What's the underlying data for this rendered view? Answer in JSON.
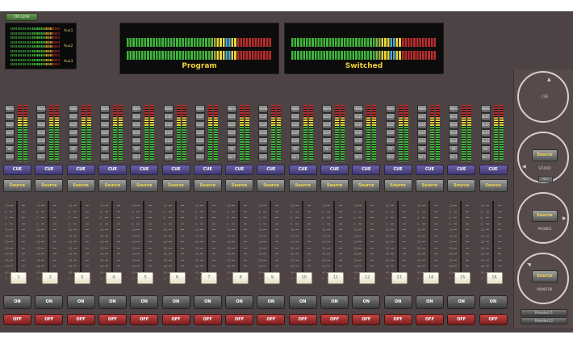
{
  "header": {
    "onair_label": "On Line",
    "aux_labels": [
      "Aux1",
      "Aux2",
      "Aux3"
    ],
    "meters": [
      {
        "label": "Program",
        "levels": [
          0.92,
          0.92
        ]
      },
      {
        "label": "Switched",
        "levels": [
          0.93,
          0.93
        ]
      }
    ]
  },
  "strip_common": {
    "source_buttons": [
      "Mgms",
      "Aux1",
      "Aux2",
      "Aux3",
      "Aux4",
      "Pfl",
      "Ovl 1"
    ],
    "cue_label": "CUE",
    "source_label": "Source",
    "on_label": "ON",
    "off_label": "OFF",
    "scale": [
      "10",
      "5",
      "0",
      "5",
      "10",
      "15",
      "20",
      "25",
      "30",
      "35",
      "40",
      "45",
      "∞"
    ]
  },
  "channels": [
    {
      "number": "1"
    },
    {
      "number": "2"
    },
    {
      "number": "3"
    },
    {
      "number": "4"
    },
    {
      "number": "5"
    },
    {
      "number": "6"
    },
    {
      "number": "7"
    },
    {
      "number": "8"
    },
    {
      "number": "9"
    },
    {
      "number": "10"
    },
    {
      "number": "11"
    },
    {
      "number": "12"
    },
    {
      "number": "13"
    },
    {
      "number": "14"
    },
    {
      "number": "15"
    },
    {
      "number": "16"
    }
  ],
  "monitor_section": {
    "cue_label": "CUE",
    "studio": {
      "label": "STUDIO",
      "source": "Source",
      "talkback": "TB 1"
    },
    "phones": {
      "label": "PHONES",
      "source": "Source"
    },
    "monitor": {
      "label": "MONITOR",
      "source": "Source"
    },
    "preselects": [
      "Preselect 1",
      "Preselect 2"
    ]
  },
  "colors": {
    "background": "#4e4344",
    "meter_green": "#3fb53c",
    "meter_yellow": "#e7d53a",
    "meter_blue": "#4aa7d8",
    "meter_red": "#b82c2c",
    "cue_button": "#5b5196",
    "off_button": "#a53535"
  }
}
